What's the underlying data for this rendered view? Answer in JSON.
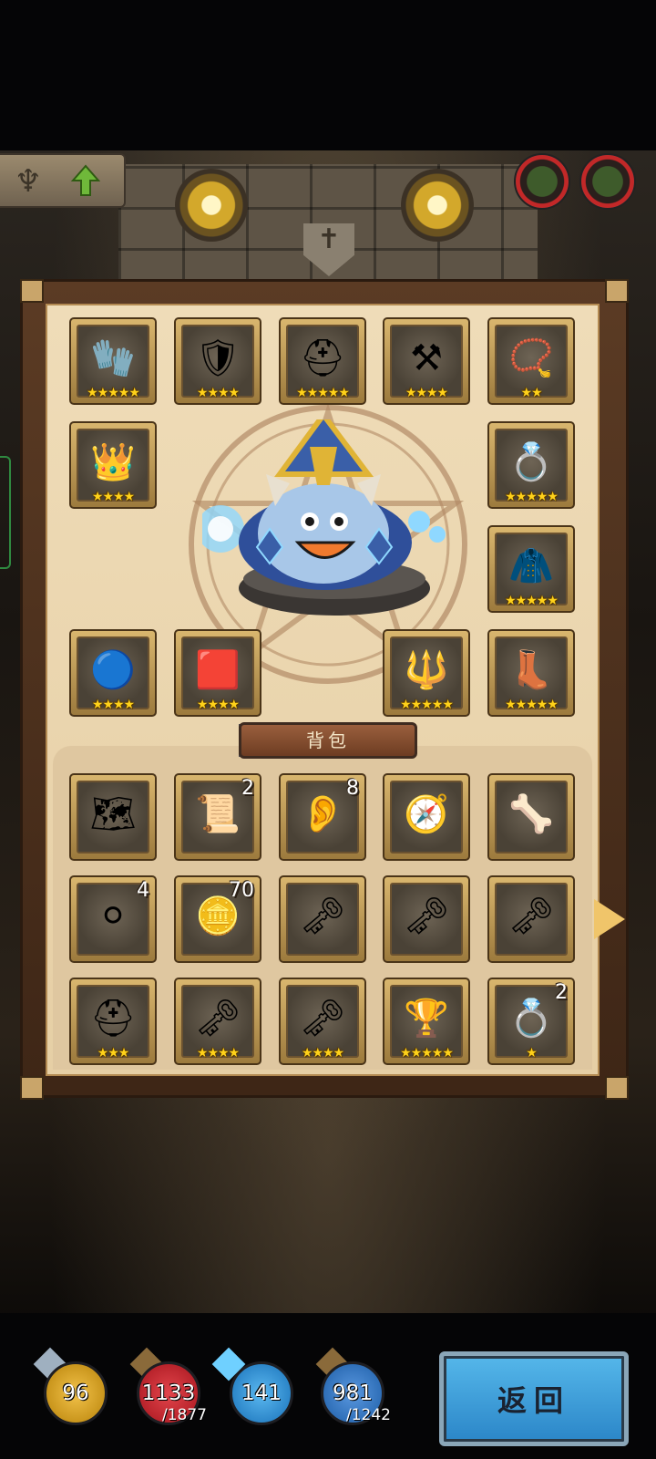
{
  "equipment_slots": [
    {
      "name": "gauntlet",
      "icon": "🧤",
      "stars": "★★★★★"
    },
    {
      "name": "golden-armor",
      "icon": "🛡",
      "stars": "★★★★"
    },
    {
      "name": "helmet",
      "icon": "⛑",
      "stars": "★★★★★"
    },
    {
      "name": "anvil",
      "icon": "⚒",
      "stars": "★★★★"
    },
    {
      "name": "amulet",
      "icon": "📿",
      "stars": "★★"
    },
    {
      "name": "crown",
      "icon": "👑",
      "stars": "★★★★"
    },
    {
      "name": "ring",
      "icon": "💍",
      "stars": "★★★★★"
    },
    {
      "name": "cloak",
      "icon": "🧥",
      "stars": "★★★★★"
    },
    {
      "name": "orb",
      "icon": "🔵",
      "stars": "★★★★"
    },
    {
      "name": "rune-tile",
      "icon": "🟥",
      "stars": "★★★★"
    },
    {
      "name": "golden-bracer",
      "icon": "🔱",
      "stars": "★★★★★"
    },
    {
      "name": "boots",
      "icon": "👢",
      "stars": "★★★★★"
    }
  ],
  "bag": {
    "title": "背包",
    "items": [
      {
        "name": "map",
        "icon": "🗺",
        "count": "",
        "stars": ""
      },
      {
        "name": "scroll",
        "icon": "📜",
        "count": "2",
        "stars": ""
      },
      {
        "name": "ear",
        "icon": "👂",
        "count": "8",
        "stars": ""
      },
      {
        "name": "compass",
        "icon": "🧭",
        "count": "",
        "stars": ""
      },
      {
        "name": "claw",
        "icon": "🦴",
        "count": "",
        "stars": ""
      },
      {
        "name": "silver-orbs",
        "icon": "⚪",
        "count": "4",
        "stars": ""
      },
      {
        "name": "bronze-coin",
        "icon": "🪙",
        "count": "70",
        "stars": ""
      },
      {
        "name": "key-blue",
        "icon": "🗝",
        "count": "",
        "stars": ""
      },
      {
        "name": "key-red",
        "icon": "🗝",
        "count": "",
        "stars": ""
      },
      {
        "name": "key-winged",
        "icon": "🗝",
        "count": "",
        "stars": ""
      },
      {
        "name": "spartan-helmet",
        "icon": "⛑",
        "count": "",
        "stars": "★★★"
      },
      {
        "name": "key-gold",
        "icon": "🗝",
        "count": "",
        "stars": "★★★★"
      },
      {
        "name": "key-sapphire",
        "icon": "🗝",
        "count": "",
        "stars": "★★★★"
      },
      {
        "name": "trophy-shield",
        "icon": "🏆",
        "count": "",
        "stars": "★★★★★"
      },
      {
        "name": "silver-ring",
        "icon": "💍",
        "count": "2",
        "stars": "★"
      }
    ]
  },
  "stats": [
    {
      "name": "attack",
      "value": "96",
      "max": "",
      "color": "#c9951c",
      "weapon_color": "#9fb0c0"
    },
    {
      "name": "health",
      "value": "1133",
      "max": "/1877",
      "color": "#b8232b",
      "weapon_color": "#8a6a3a"
    },
    {
      "name": "magic",
      "value": "141",
      "max": "",
      "color": "#2c86c9",
      "weapon_color": "#6fd0ff"
    },
    {
      "name": "mana",
      "value": "981",
      "max": "/1242",
      "color": "#2f6fb8",
      "weapon_color": "#8a6a3a"
    }
  ],
  "return_button": {
    "label": "返回"
  },
  "colors": {
    "parchment": "#efdcb8",
    "frame": "#5b3b24",
    "star": "#ffd21a",
    "button": "#3a9bd9"
  }
}
